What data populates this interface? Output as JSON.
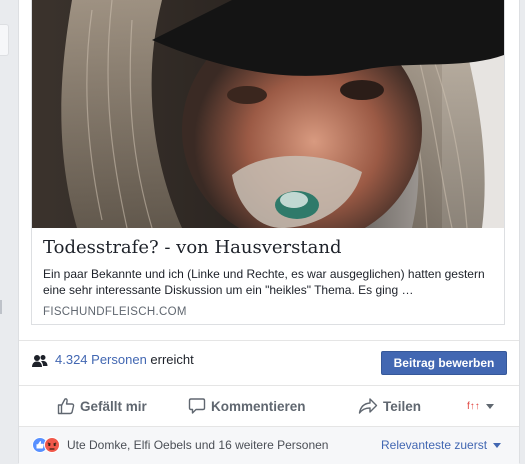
{
  "post": {
    "link_preview": {
      "title": "Todesstrafe? - von Hausverstand",
      "description": "Ein paar Bekannte und ich (Linke und Rechte, es war ausgeglichen) hatten gestern eine sehr interessante Diskussion um ein \"heikles\" Thema. Es ging …",
      "domain": "FISCHUNDFLEISCH.COM"
    },
    "reach": {
      "count": "4.324 Personen",
      "suffix": " erreicht",
      "boost_label": "Beitrag bewerben"
    },
    "actions": {
      "like": "Gefällt mir",
      "comment": "Kommentieren",
      "share": "Teilen",
      "reaction_selector": "f↑↑"
    },
    "summary": {
      "text": "Ute Domke, Elfi Oebels und 16 weitere Personen",
      "sort_label": "Relevanteste zuerst"
    }
  },
  "colors": {
    "accent": "#4267b2",
    "like_reaction": "#5890ff",
    "angry_reaction": "#f0584a"
  },
  "icons": [
    "people-icon",
    "thumbs-up-icon",
    "comment-icon",
    "share-icon",
    "like-reaction-icon",
    "angry-reaction-icon",
    "chevron-down-icon"
  ]
}
